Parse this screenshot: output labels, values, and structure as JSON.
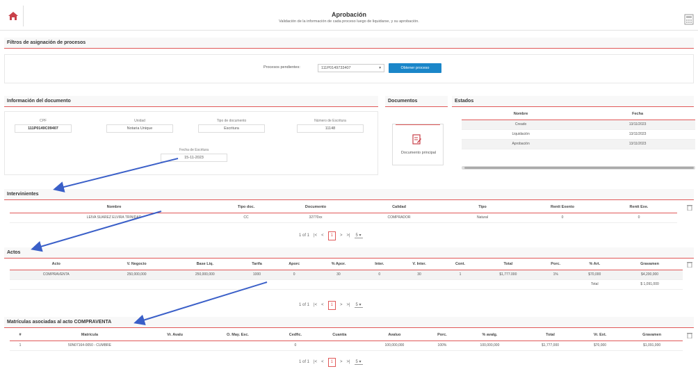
{
  "header": {
    "title": "Aprobación",
    "subtitle": "Validación de la información de cada proceso luego de liquidarse, y su aprobación."
  },
  "filtros": {
    "section_title": "Filtros de asignación de procesos",
    "label": "Procesos pendientes:",
    "select_value": "111P0149733407",
    "button_label": "Obtener proceso"
  },
  "info_doc": {
    "section_title": "Información del documento",
    "fields": [
      {
        "label": "CPF",
        "value": "111P0149C09407"
      },
      {
        "label": "Unidad",
        "value": "Notaria Unique"
      },
      {
        "label": "Tipo de documento",
        "value": "Escritura"
      },
      {
        "label": "Número de Escritura",
        "value": "11148"
      }
    ],
    "fecha": {
      "label": "Fecha de Escritura",
      "value": "15-11-2023"
    }
  },
  "documentos": {
    "section_title": "Documentos",
    "card_label": "Documento principal"
  },
  "estados": {
    "section_title": "Estados",
    "headers": [
      "Nombre",
      "Fecha"
    ],
    "rows": [
      [
        "Creado",
        "13/11/2023"
      ],
      [
        "Liquidación",
        "13/11/2023"
      ],
      [
        "Aprobación",
        "13/11/2023"
      ]
    ]
  },
  "intervinientes": {
    "section_title": "Intervinientes",
    "headers": [
      "Nombre",
      "Tipo doc.",
      "Documento",
      "Calidad",
      "Tipo",
      "Rentt Exento",
      "Rentt Exe.",
      ""
    ],
    "rows": [
      [
        "LEIVA SUAREZ ELVIRA TRINIDAD",
        "CC",
        "32770xx",
        "COMPRADOR",
        "Natural",
        "0",
        "0"
      ]
    ],
    "pager": {
      "info": "1 of 1",
      "page": "1",
      "size": "5"
    }
  },
  "actos": {
    "section_title": "Actos",
    "headers": [
      "Acto",
      "V. Negocio",
      "Base Liq.",
      "Tarifa",
      "Aporc",
      "% Apor.",
      "Inter.",
      "V. Inter.",
      "Cont.",
      "Total",
      "Porc.",
      "% Art.",
      "Gravamen"
    ],
    "rows": [
      [
        "COMPRAVENTA",
        "250,000,000",
        "250,000,000",
        "1000",
        "0",
        "30",
        "0",
        "30",
        "1",
        "$1,777.000",
        "1%",
        "$70,000",
        "$4,200,000"
      ]
    ],
    "total_label": "Total",
    "total_value": "$ 1,091,000",
    "pager": {
      "info": "1 of 1",
      "page": "1",
      "size": "5"
    }
  },
  "matriculas": {
    "section_title": "Matrículas asociadas al acto COMPRAVENTA",
    "headers": [
      "#",
      "Matrícula",
      "Vr. Avalu",
      "O. May. Esc.",
      "Cedfic.",
      "Cuantía",
      "Avaluo",
      "Porc.",
      "% avalg.",
      "Total",
      "Vr. Ext.",
      "Gravamen"
    ],
    "rows": [
      [
        "1",
        "50N07164-0050 - CUMBRE",
        "",
        "",
        "0",
        "",
        "100,000,000",
        "100%",
        "100,000,000",
        "$1,777,000",
        "$70,000",
        "$1,091,000"
      ]
    ],
    "pager": {
      "info": "1 of 1",
      "page": "1",
      "size": "5"
    }
  },
  "colors": {
    "accent_red": "#e05858",
    "button_blue": "#1a86c9",
    "annotation_arrow": "#3a5fc8"
  }
}
